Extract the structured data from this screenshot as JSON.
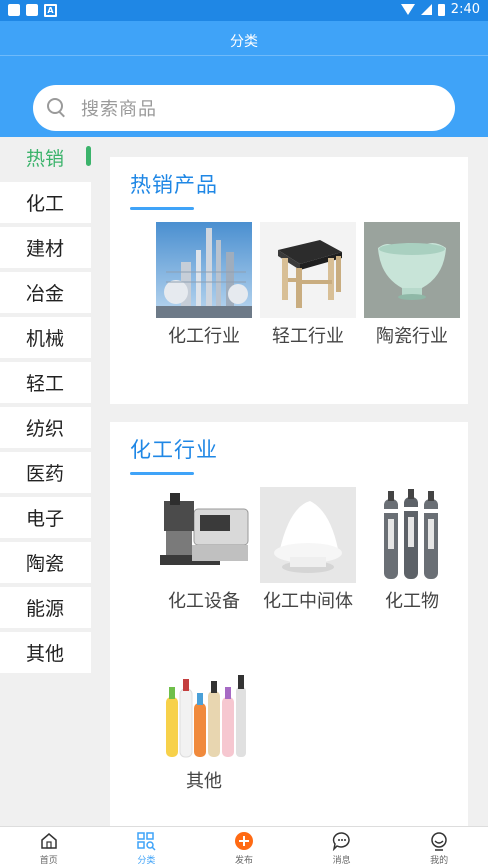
{
  "status_bar": {
    "time": "2:40"
  },
  "header": {
    "title": "分类"
  },
  "search": {
    "placeholder": "搜索商品"
  },
  "sidebar": {
    "items": [
      {
        "label": "热销"
      },
      {
        "label": "化工"
      },
      {
        "label": "建材"
      },
      {
        "label": "冶金"
      },
      {
        "label": "机械"
      },
      {
        "label": "轻工"
      },
      {
        "label": "纺织"
      },
      {
        "label": "医药"
      },
      {
        "label": "电子"
      },
      {
        "label": "陶瓷"
      },
      {
        "label": "能源"
      },
      {
        "label": "其他"
      }
    ]
  },
  "sections": [
    {
      "title": "热销产品",
      "tiles": [
        {
          "label": "化工行业",
          "icon": "chemical-plant-image"
        },
        {
          "label": "轻工行业",
          "icon": "stool-image"
        },
        {
          "label": "陶瓷行业",
          "icon": "ceramic-bowl-image"
        }
      ]
    },
    {
      "title": "化工行业",
      "tiles": [
        {
          "label": "化工设备",
          "icon": "lab-instrument-image"
        },
        {
          "label": "化工中间体",
          "icon": "white-powder-image"
        },
        {
          "label": "化工物",
          "icon": "gas-cylinders-image"
        },
        {
          "label": "其他",
          "icon": "plastic-bottles-image"
        }
      ]
    }
  ],
  "bottom_nav": {
    "items": [
      {
        "label": "首页"
      },
      {
        "label": "分类"
      },
      {
        "label": "发布"
      },
      {
        "label": "消息"
      },
      {
        "label": "我的"
      }
    ]
  },
  "colors": {
    "primary": "#3fa3f8",
    "accent_green": "#3bb36b",
    "title_blue": "#1f87e5",
    "publish_orange": "#ff6a13"
  }
}
